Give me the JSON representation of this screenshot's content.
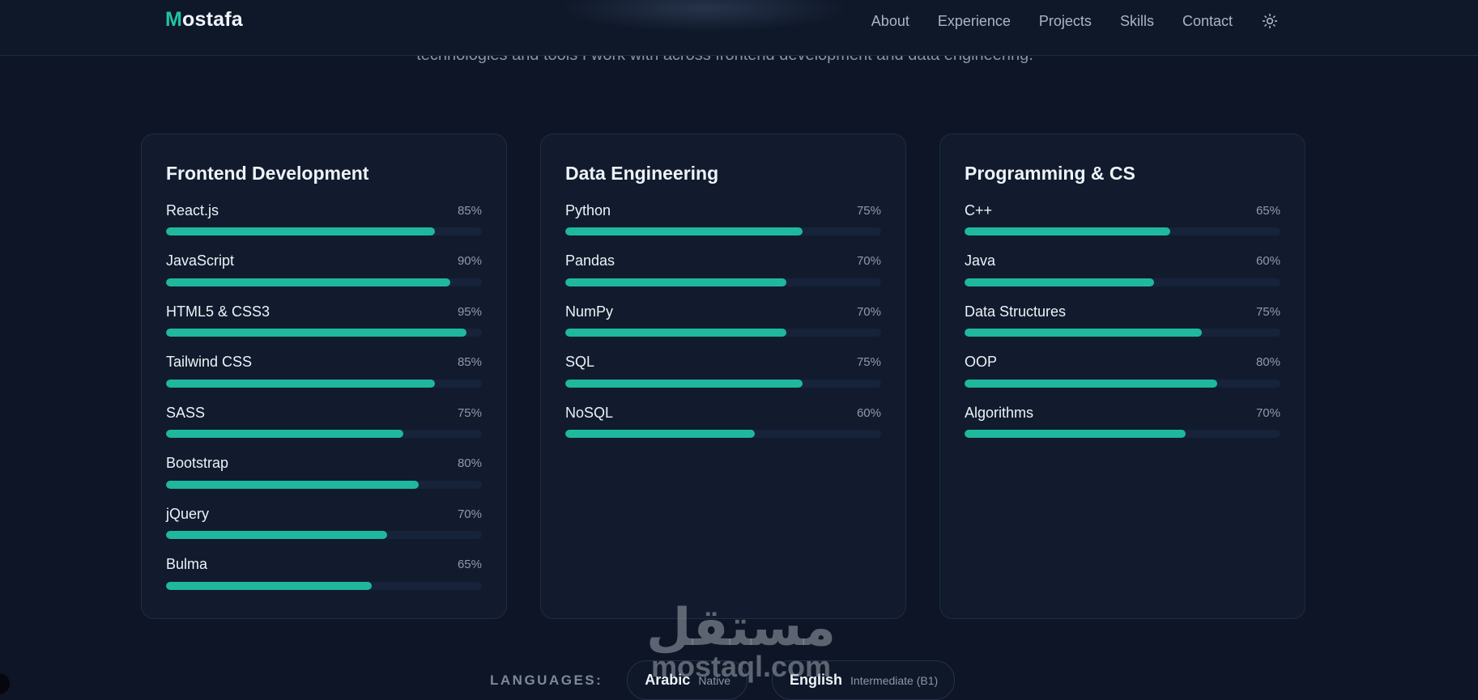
{
  "header": {
    "logo_first": "M",
    "logo_rest": "ostafa",
    "nav": [
      "About",
      "Experience",
      "Projects",
      "Skills",
      "Contact"
    ],
    "theme_icon": "sun-icon"
  },
  "section": {
    "subtitle": "technologies and tools I work with across frontend development and data engineering."
  },
  "cards": [
    {
      "title": "Frontend Development",
      "skills": [
        {
          "name": "React.js",
          "percent": "85%"
        },
        {
          "name": "JavaScript",
          "percent": "90%"
        },
        {
          "name": "HTML5 & CSS3",
          "percent": "95%"
        },
        {
          "name": "Tailwind CSS",
          "percent": "85%"
        },
        {
          "name": "SASS",
          "percent": "75%"
        },
        {
          "name": "Bootstrap",
          "percent": "80%"
        },
        {
          "name": "jQuery",
          "percent": "70%"
        },
        {
          "name": "Bulma",
          "percent": "65%"
        }
      ]
    },
    {
      "title": "Data Engineering",
      "skills": [
        {
          "name": "Python",
          "percent": "75%"
        },
        {
          "name": "Pandas",
          "percent": "70%"
        },
        {
          "name": "NumPy",
          "percent": "70%"
        },
        {
          "name": "SQL",
          "percent": "75%"
        },
        {
          "name": "NoSQL",
          "percent": "60%"
        }
      ]
    },
    {
      "title": "Programming & CS",
      "skills": [
        {
          "name": "C++",
          "percent": "65%"
        },
        {
          "name": "Java",
          "percent": "60%"
        },
        {
          "name": "Data Structures",
          "percent": "75%"
        },
        {
          "name": "OOP",
          "percent": "80%"
        },
        {
          "name": "Algorithms",
          "percent": "70%"
        }
      ]
    }
  ],
  "languages": {
    "label": "LANGUAGES:",
    "items": [
      {
        "name": "Arabic",
        "level": "Native"
      },
      {
        "name": "English",
        "level": "Intermediate (B1)"
      }
    ]
  },
  "watermark": {
    "arabic": "مستقل",
    "latin": "mostaql.com"
  },
  "colors": {
    "accent": "#1fb89e",
    "background": "#0d1526",
    "card": "#111b2d"
  }
}
